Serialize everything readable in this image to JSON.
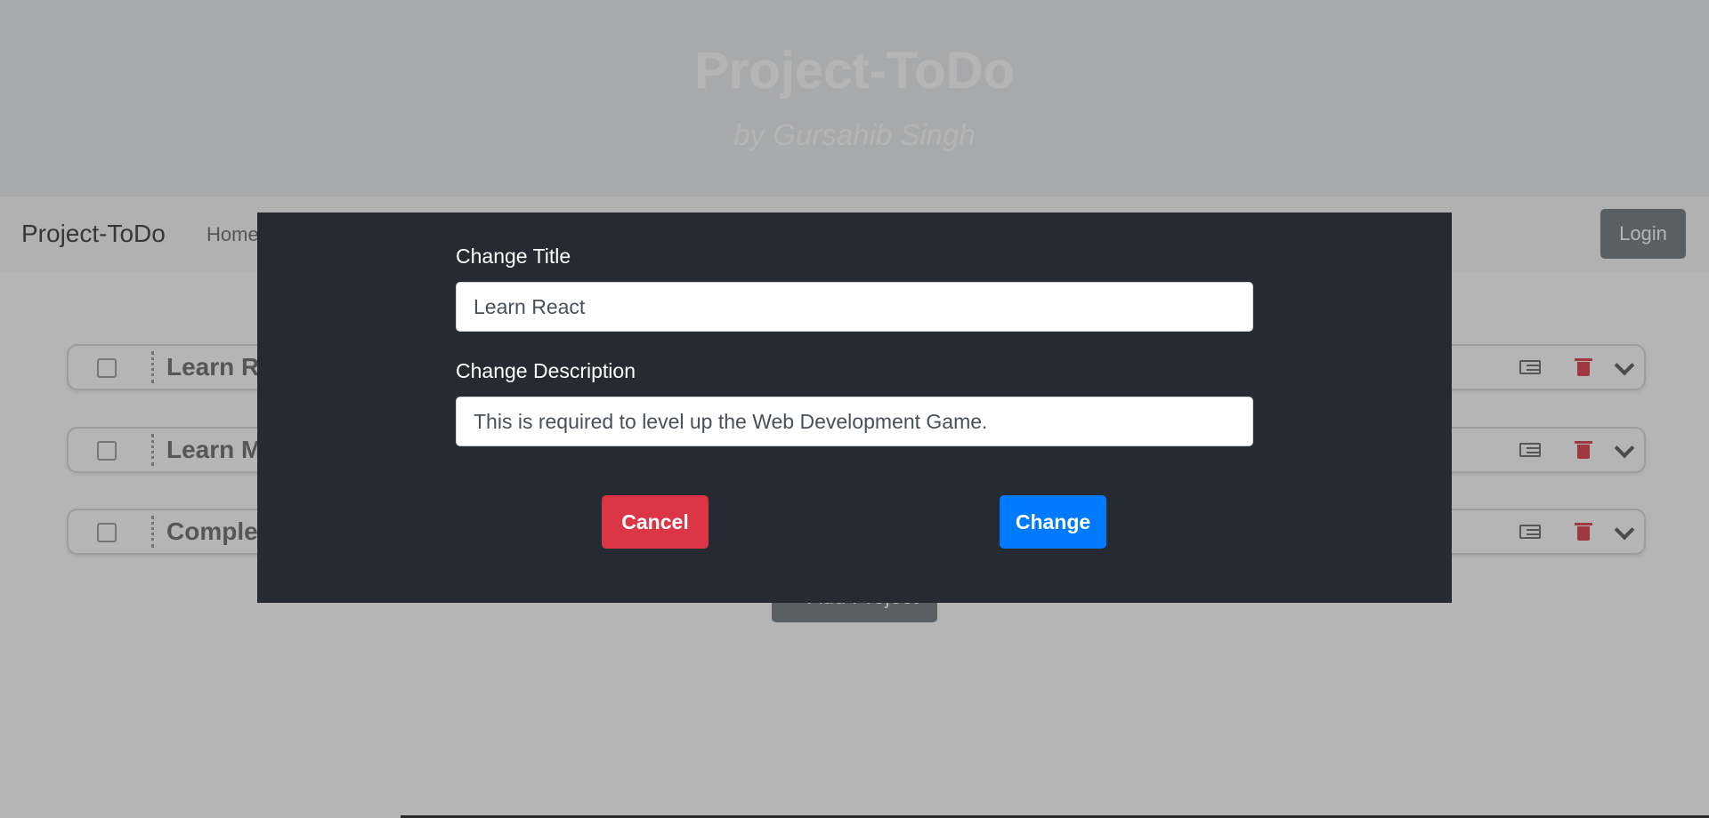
{
  "header": {
    "title": "Project-ToDo",
    "subtitle": "by Gursahib Singh"
  },
  "navbar": {
    "brand": "Project-ToDo",
    "links": [
      "Home"
    ],
    "login_label": "Login"
  },
  "todos": [
    {
      "title_visible": "Learn R"
    },
    {
      "title_visible": "Learn M"
    },
    {
      "title_visible": "Comple"
    }
  ],
  "add_project_label": "+ Add Project",
  "modal": {
    "title_label": "Change Title",
    "title_value": "Learn React",
    "description_label": "Change Description",
    "description_value": "This is required to level up the Web Development Game.",
    "cancel_label": "Cancel",
    "change_label": "Change"
  },
  "colors": {
    "danger": "#dc3545",
    "primary": "#007bff",
    "modal_bg": "#262a33",
    "secondary": "#6c757d"
  },
  "icons": [
    "detail-icon",
    "trash-icon",
    "chevron-down-icon"
  ]
}
